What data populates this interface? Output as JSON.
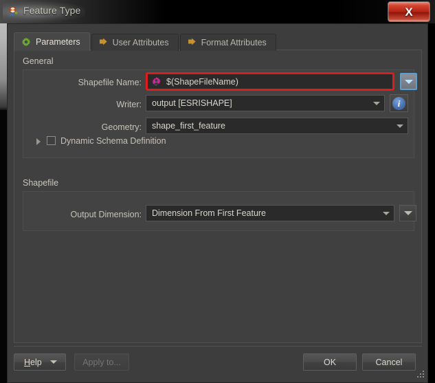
{
  "window": {
    "title": "Feature Type",
    "icon": "feature-type-icon",
    "close_label": "X"
  },
  "tabs": [
    {
      "label": "Parameters",
      "icon": "green-gear-icon",
      "active": true
    },
    {
      "label": "User Attributes",
      "icon": "orange-arrow-icon",
      "active": false
    },
    {
      "label": "Format Attributes",
      "icon": "orange-arrow-icon",
      "active": false
    }
  ],
  "general": {
    "title": "General",
    "shapefile_name": {
      "label": "Shapefile Name:",
      "value": "$(ShapeFileName)",
      "icon": "user-parameter-gear-icon",
      "highlight_color": "#e01b1b",
      "dropdown_icon": "chevron-down-icon"
    },
    "writer": {
      "label": "Writer:",
      "value": "output [ESRISHAPE]",
      "info_icon": "info-icon",
      "caret_icon": "chevron-down-icon"
    },
    "geometry": {
      "label": "Geometry:",
      "value": "shape_first_feature",
      "caret_icon": "chevron-down-icon"
    },
    "dynamic_schema": {
      "label": "Dynamic Schema Definition",
      "checked": false,
      "expander_icon": "triangle-right-icon"
    }
  },
  "shapefile": {
    "title": "Shapefile",
    "output_dimension": {
      "label": "Output Dimension:",
      "value": "Dimension From First Feature",
      "caret_icon": "chevron-down-icon",
      "dropdown_icon": "chevron-down-icon"
    }
  },
  "buttons": {
    "help": {
      "label_pre": "",
      "label_accel": "H",
      "label_post": "elp",
      "caret_icon": "chevron-down-icon"
    },
    "apply_to": {
      "label": "Apply to...",
      "enabled": false
    },
    "ok": {
      "label": "OK"
    },
    "cancel": {
      "label": "Cancel"
    }
  },
  "colors": {
    "accent_red": "#e01b1b",
    "accent_blue": "#5a9fd4",
    "tab_active_green": "#6aa832",
    "tab_arrow_orange": "#c8912f",
    "panel_bg": "#404040",
    "group_bg": "#434343",
    "field_bg": "#2a2a2a"
  }
}
